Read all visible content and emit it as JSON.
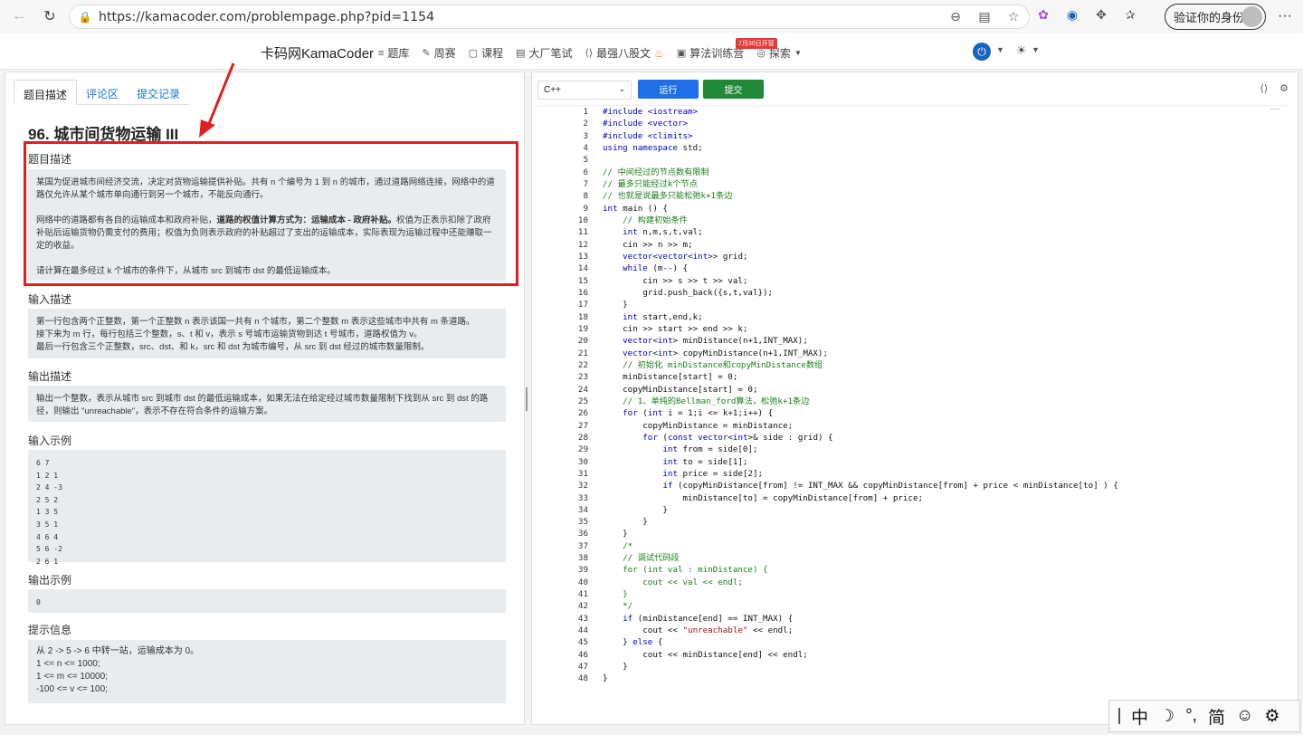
{
  "browser": {
    "url": "https://kamacoder.com/problempage.php?pid=1154",
    "profile_label": "验证你的身份"
  },
  "site": {
    "brand": "卡码网KamaCoder",
    "nav": [
      "题库",
      "周赛",
      "课程",
      "大厂笔试",
      "最强八股文",
      "算法训练营",
      "探索"
    ],
    "badge": "7月30日开营"
  },
  "problem": {
    "tabs": [
      "题目描述",
      "评论区",
      "提交记录"
    ],
    "title": "96. 城市间货物运输 III",
    "desc_label": "题目描述",
    "desc_p1": "某国为促进城市间经济交流，决定对货物运输提供补贴。共有 n 个编号为 1 到 n 的城市，通过道路网络连接，网络中的道路仅允许从某个城市单向通行到另一个城市，不能反向通行。",
    "desc_p2_a": "网络中的道路都有各自的运输成本和政府补贴，",
    "desc_p2_bold": "道路的权值计算方式为：运输成本 - 政府补贴。",
    "desc_p2_b": "权值为正表示扣除了政府补贴后运输货物仍需支付的费用；权值为负则表示政府的补贴超过了支出的运输成本，实际表现为运输过程中还能赚取一定的收益。",
    "desc_p3": "请计算在最多经过 k 个城市的条件下，从城市 src 到城市 dst 的最低运输成本。",
    "input_label": "输入描述",
    "input_lines": [
      "第一行包含两个正整数，第一个正整数 n 表示该国一共有 n 个城市，第二个整数 m 表示这些城市中共有 m 条道路。",
      "接下来为 m 行，每行包括三个整数，s、t 和 v，表示 s 号城市运输货物到达 t 号城市，道路权值为 v。",
      "最后一行包含三个正整数，src、dst、和 k，src 和 dst 为城市编号，从 src 到 dst 经过的城市数量限制。"
    ],
    "output_label": "输出描述",
    "output_text": "输出一个整数，表示从城市 src 到城市 dst 的最低运输成本，如果无法在给定经过城市数量限制下找到从 src 到 dst 的路径，则输出 \"unreachable\"，表示不存在符合条件的运输方案。",
    "sample_in_label": "输入示例",
    "sample_in": "6 7\n1 2 1\n2 4 -3\n2 5 2\n1 3 5\n3 5 1\n4 6 4\n5 6 -2\n2 6 1",
    "sample_out_label": "输出示例",
    "sample_out": "0",
    "hint_label": "提示信息",
    "hint_lines": [
      "从 2 -> 5 -> 6 中转一站，运输成本为 0。",
      "1 <= n <= 1000;",
      "1 <= m <= 10000;",
      "-100 <= v <= 100;"
    ]
  },
  "editor": {
    "language": "C++",
    "run_label": "运行",
    "submit_label": "提交",
    "code": [
      "#include <iostream>",
      "#include <vector>",
      "#include <climits>",
      "using namespace std;",
      "",
      "// 中间经过的节点数有限制",
      "// 最多只能经过k个节点",
      "// 也就是说最多只能松弛k+1条边",
      "int main () {",
      "    // 构建初始条件",
      "    int n,m,s,t,val;",
      "    cin >> n >> m;",
      "    vector<vector<int>> grid;",
      "    while (m--) {",
      "        cin >> s >> t >> val;",
      "        grid.push_back({s,t,val});",
      "    }",
      "    int start,end,k;",
      "    cin >> start >> end >> k;",
      "    vector<int> minDistance(n+1,INT_MAX);",
      "    vector<int> copyMinDistance(n+1,INT_MAX);",
      "    // 初始化 minDistance和copyMinDistance数组",
      "    minDistance[start] = 0;",
      "    copyMinDistance[start] = 0;",
      "    // 1、单纯的Bellman_ford算法，松弛k+1条边",
      "    for (int i = 1;i <= k+1;i++) {",
      "        copyMinDistance = minDistance;",
      "        for (const vector<int>& side : grid) {",
      "            int from = side[0];",
      "            int to = side[1];",
      "            int price = side[2];",
      "            if (copyMinDistance[from] != INT_MAX && copyMinDistance[from] + price < minDistance[to] ) {",
      "                minDistance[to] = copyMinDistance[from] + price;",
      "            }",
      "        }",
      "    }",
      "    /*",
      "    // 调试代码段",
      "    for (int val : minDistance) {",
      "        cout << val << endl;",
      "    }",
      "    */",
      "    if (minDistance[end] == INT_MAX) {",
      "        cout << \"unreachable\" << endl;",
      "    } else {",
      "        cout << minDistance[end] << endl;",
      "    }",
      "}"
    ]
  },
  "ime": [
    "中",
    "简"
  ],
  "colors": {
    "accent": "#1e6fe8",
    "submit": "#218838",
    "highlight_frame": "#e02020",
    "keyword": "#0000c8",
    "comment": "#1a7f1a",
    "string": "#a31515"
  }
}
